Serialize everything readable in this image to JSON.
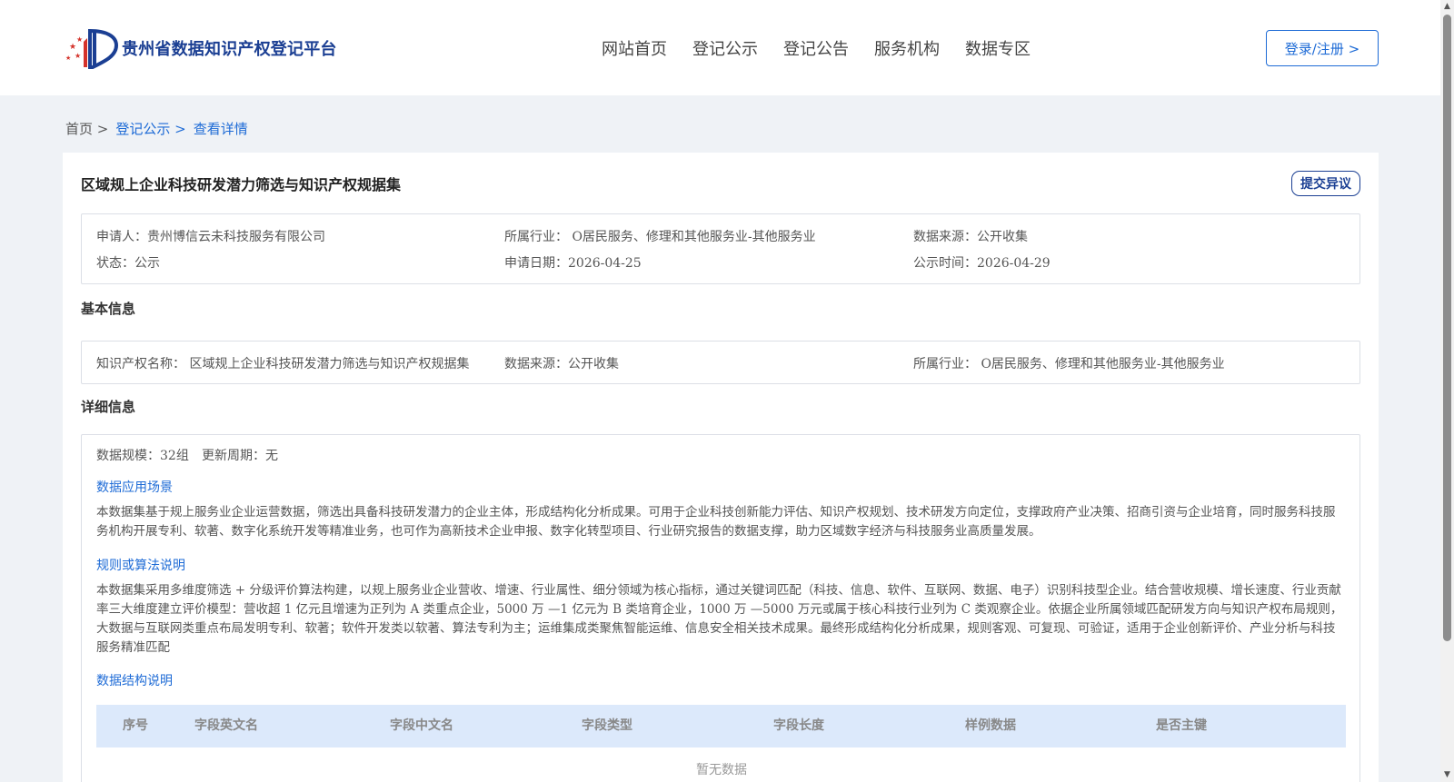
{
  "header": {
    "logo_text": "贵州省数据知识产权登记平台",
    "nav": [
      "网站首页",
      "登记公示",
      "登记公告",
      "服务机构",
      "数据专区"
    ],
    "login_label": "登录/注册 >"
  },
  "breadcrumb": {
    "home": "首页 >",
    "level1": "登记公示 >",
    "level2": "查看详情"
  },
  "record": {
    "title": "区域规上企业科技研发潜力筛选与知识产权规据集",
    "objection_label": "提交异议",
    "applicant": "申请人：贵州博信云未科技服务有限公司",
    "industry": "所属行业： O居民服务、修理和其他服务业-其他服务业",
    "source": "数据来源：公开收集",
    "status": "状态：公示",
    "apply_date": "申请日期：2026-04-25",
    "publish_date": "公示时间：2026-04-29"
  },
  "basic": {
    "section_title": "基本信息",
    "ip_name": "知识产权名称： 区域规上企业科技研发潜力筛选与知识产权规据集",
    "source": "数据来源：公开收集",
    "industry": "所属行业： O居民服务、修理和其他服务业-其他服务业"
  },
  "detail": {
    "section_title": "详细信息",
    "scale": "数据规模：32组",
    "update_cycle": "更新周期：无",
    "scenario_title": "数据应用场景",
    "scenario_text": "本数据集基于规上服务业企业运营数据，筛选出具备科技研发潜力的企业主体，形成结构化分析成果。可用于企业科技创新能力评估、知识产权规划、技术研发方向定位，支撑政府产业决策、招商引资与企业培育，同时服务科技服务机构开展专利、软著、数字化系统开发等精准业务，也可作为高新技术企业申报、数字化转型项目、行业研究报告的数据支撑，助力区域数字经济与科技服务业高质量发展。",
    "rules_title": "规则或算法说明",
    "rules_text": "本数据集采用多维度筛选 + 分级评价算法构建，以规上服务业企业营收、增速、行业属性、细分领域为核心指标，通过关键词匹配（科技、信息、软件、互联网、数据、电子）识别科技型企业。结合营收规模、增长速度、行业贡献率三大维度建立评价模型：营收超 1 亿元且增速为正列为 A 类重点企业，5000 万 —1 亿元为 B 类培育企业，1000 万 —5000 万元或属于核心科技行业列为 C 类观察企业。依据企业所属领域匹配研发方向与知识产权布局规则，大数据与互联网类重点布局发明专利、软著；软件开发类以软著、算法专利为主；运维集成类聚焦智能运维、信息安全相关技术成果。最终形成结构化分析成果，规则客观、可复现、可验证，适用于企业创新评价、产业分析与科技服务精准匹配",
    "structure_title": "数据结构说明",
    "table_headers": [
      "序号",
      "字段英文名",
      "字段中文名",
      "字段类型",
      "字段长度",
      "样例数据",
      "是否主键"
    ],
    "empty_text": "暂无数据"
  }
}
